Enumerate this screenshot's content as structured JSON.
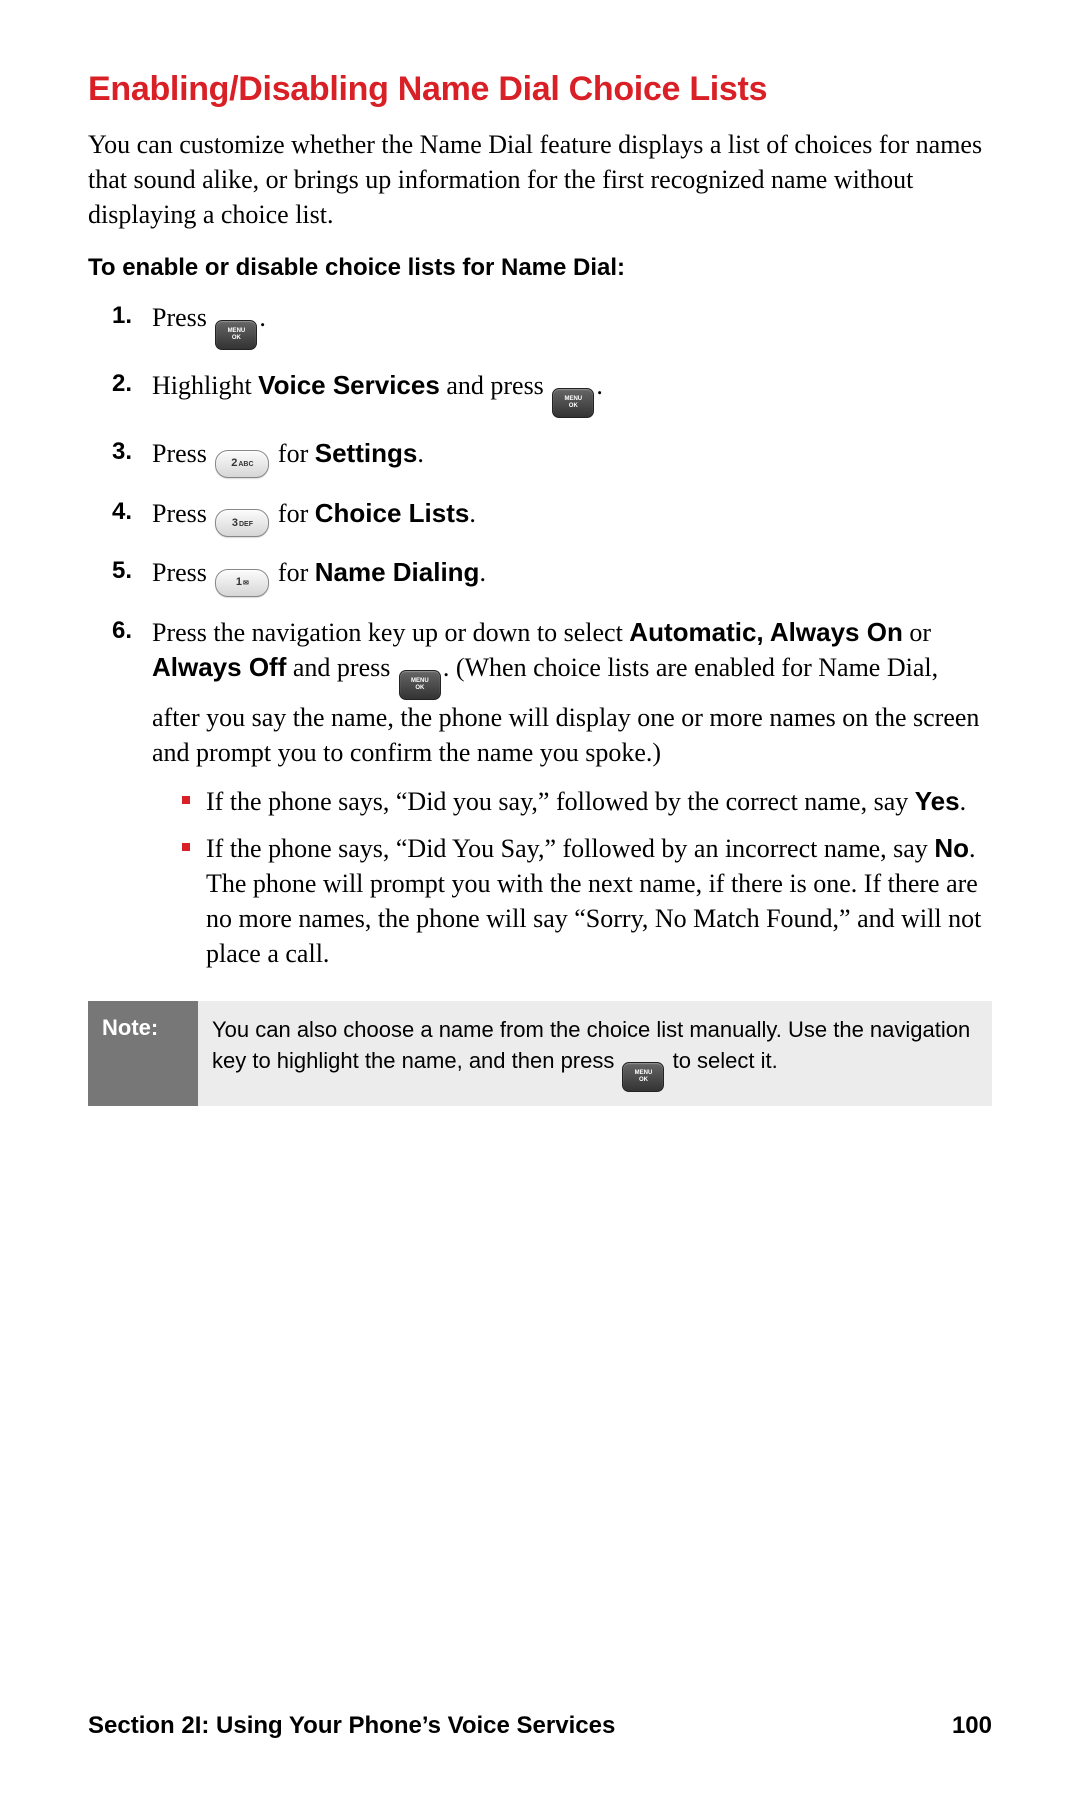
{
  "title": "Enabling/Disabling Name Dial Choice Lists",
  "intro": "You can customize whether the Name Dial feature displays a list of choices for names that sound alike, or brings up information for the first recognized name without displaying a choice list.",
  "subhead": "To enable or disable choice lists for Name Dial:",
  "key": {
    "menuok_line1": "MENU",
    "menuok_line2": "OK",
    "k2_main": "2",
    "k2_sub": "ABC",
    "k3_main": "3",
    "k3_sub": "DEF",
    "k1_main": "1",
    "k1_sub": "✉"
  },
  "steps": {
    "s1": {
      "num": "1.",
      "a": "Press ",
      "b": "."
    },
    "s2": {
      "num": "2.",
      "a": "Highlight ",
      "bold": "Voice Services",
      "b": " and press ",
      "c": "."
    },
    "s3": {
      "num": "3.",
      "a": "Press ",
      "b": " for ",
      "bold": "Settings",
      "c": "."
    },
    "s4": {
      "num": "4.",
      "a": "Press ",
      "b": " for ",
      "bold": "Choice Lists",
      "c": "."
    },
    "s5": {
      "num": "5.",
      "a": "Press ",
      "b": " for ",
      "bold": "Name Dialing",
      "c": "."
    },
    "s6": {
      "num": "6.",
      "a": "Press the navigation key up or down to select ",
      "bold1": "Automatic, Always On",
      "mid": " or ",
      "bold2": "Always Off",
      "b": " and press ",
      "c": ". (When choice lists are enabled for Name Dial, after you say the name, the phone will display one or more names on the screen and prompt you to confirm the name you spoke.)"
    }
  },
  "sub": {
    "b1": {
      "a": "If the phone says, “Did you say,” followed by the correct name, say ",
      "bold": "Yes",
      "b": "."
    },
    "b2": {
      "a": "If the phone says, “Did You Say,” followed by an incorrect name, say ",
      "bold": "No",
      "b": ". The phone will prompt you with the next name, if there is one. If there are no more names, the phone will say “Sorry, No Match Found,” and will not place a call."
    }
  },
  "note": {
    "label": "Note:",
    "a": "You can also choose a name from the choice list manually. Use the navigation key to highlight the name, and then press ",
    "b": " to select it."
  },
  "footer": {
    "section": "Section 2I: Using Your Phone’s Voice Services",
    "page": "100"
  }
}
